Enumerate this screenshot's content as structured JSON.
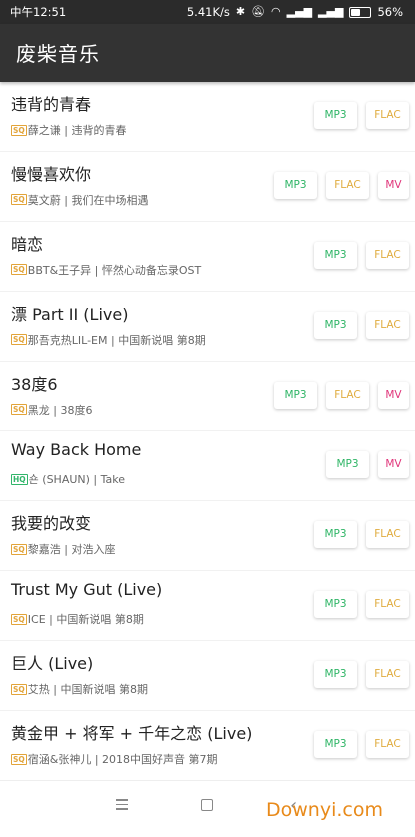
{
  "status_bar": {
    "time": "中午12:51",
    "network_speed": "5.41K/s",
    "battery": "56%",
    "battery_level": 0.56
  },
  "app_bar": {
    "title": "废柴音乐"
  },
  "colors": {
    "mp3": "#2fb566",
    "flac": "#e0ac3f",
    "mv": "#e0357a",
    "appbar": "#333333"
  },
  "songs": [
    {
      "title": "违背的青春",
      "badge": "SQ",
      "meta": "薛之谦 | 违背的青春",
      "buttons": [
        "MP3",
        "FLAC"
      ]
    },
    {
      "title": "慢慢喜欢你",
      "badge": "SQ",
      "meta": "莫文蔚 | 我们在中场相遇",
      "buttons": [
        "MP3",
        "FLAC",
        "MV"
      ]
    },
    {
      "title": "暗恋",
      "badge": "SQ",
      "meta": "BBT&王子异 | 怦然心动备忘录OST",
      "buttons": [
        "MP3",
        "FLAC"
      ]
    },
    {
      "title": "漂 Part II (Live)",
      "badge": "SQ",
      "meta": "那吾克热LIL-EM | 中国新说唱 第8期",
      "buttons": [
        "MP3",
        "FLAC"
      ]
    },
    {
      "title": "38度6",
      "badge": "SQ",
      "meta": "黑龙 | 38度6",
      "buttons": [
        "MP3",
        "FLAC",
        "MV"
      ]
    },
    {
      "title": "Way Back Home",
      "badge": "HQ",
      "meta": "숀 (SHAUN) | Take",
      "buttons": [
        "MP3",
        "MV"
      ]
    },
    {
      "title": "我要的改变",
      "badge": "SQ",
      "meta": "黎嘉浩 | 对浩入座",
      "buttons": [
        "MP3",
        "FLAC"
      ]
    },
    {
      "title": "Trust My Gut (Live)",
      "badge": "SQ",
      "meta": "ICE | 中国新说唱 第8期",
      "buttons": [
        "MP3",
        "FLAC"
      ]
    },
    {
      "title": "巨人 (Live)",
      "badge": "SQ",
      "meta": "艾热 | 中国新说唱 第8期",
      "buttons": [
        "MP3",
        "FLAC"
      ]
    },
    {
      "title": "黄金甲 + 将军 + 千年之恋 (Live)",
      "badge": "SQ",
      "meta": "宿涵&张神儿 | 2018中国好声音 第7期",
      "buttons": [
        "MP3",
        "FLAC"
      ]
    }
  ],
  "watermark": "Downyi.com"
}
